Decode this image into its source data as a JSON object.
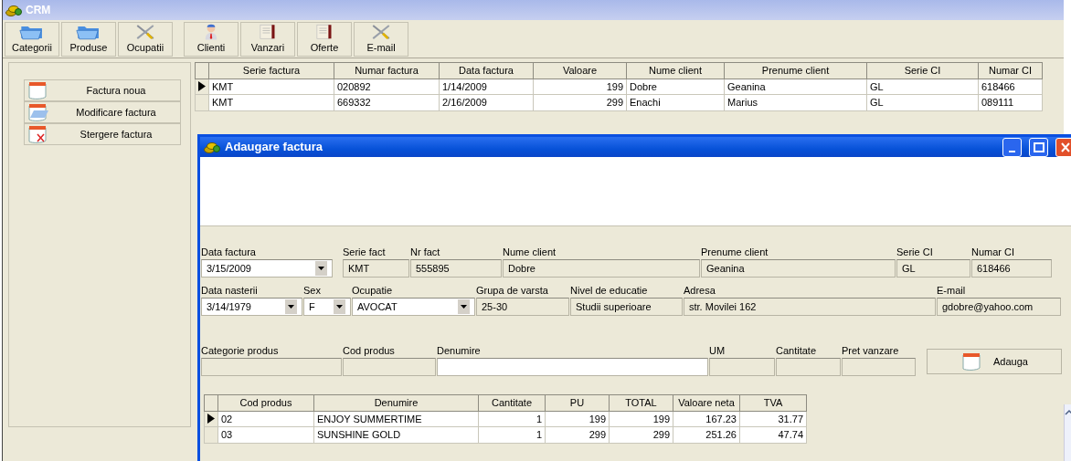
{
  "window": {
    "title": "CRM"
  },
  "toolbar": [
    {
      "label": "Categorii",
      "kind": "folder"
    },
    {
      "label": "Produse",
      "kind": "folder"
    },
    {
      "label": "Ocupatii",
      "kind": "tools"
    },
    {
      "label": "Clienti",
      "kind": "person"
    },
    {
      "label": "Vanzari",
      "kind": "ledger"
    },
    {
      "label": "Oferte",
      "kind": "ledger"
    },
    {
      "label": "E-mail",
      "kind": "tools"
    }
  ],
  "actions": [
    {
      "label": "Factura noua",
      "kind": "new"
    },
    {
      "label": "Modificare factura",
      "kind": "edit"
    },
    {
      "label": "Stergere factura",
      "kind": "delete"
    }
  ],
  "invoices": {
    "columns": [
      "Serie factura",
      "Numar factura",
      "Data factura",
      "Valoare",
      "Nume client",
      "Prenume client",
      "Serie CI",
      "Numar CI"
    ],
    "rows": [
      {
        "selected": true,
        "cells": [
          "KMT",
          "020892",
          "1/14/2009",
          "199",
          "Dobre",
          "Geanina",
          "GL",
          "618466"
        ]
      },
      {
        "selected": false,
        "cells": [
          "KMT",
          "669332",
          "2/16/2009",
          "299",
          "Enachi",
          "Marius",
          "GL",
          "089111"
        ]
      }
    ]
  },
  "dialog": {
    "title": "Adaugare factura",
    "form_rows": [
      [
        {
          "label": "Data factura",
          "value": "3/15/2009",
          "kind": "date"
        },
        {
          "label": "Serie fact",
          "value": "KMT",
          "kind": "readonly"
        },
        {
          "label": "Nr fact",
          "value": "555895",
          "kind": "readonly"
        },
        {
          "label": "Nume client",
          "value": "Dobre",
          "kind": "readonly"
        },
        {
          "label": "Prenume client",
          "value": "Geanina",
          "kind": "readonly"
        },
        {
          "label": "Serie CI",
          "value": "GL",
          "kind": "readonly"
        },
        {
          "label": "Numar CI",
          "value": "618466",
          "kind": "readonly"
        }
      ],
      [
        {
          "label": "Data nasterii",
          "value": "3/14/1979",
          "kind": "date"
        },
        {
          "label": "Sex",
          "value": "F",
          "kind": "combo"
        },
        {
          "label": "Ocupatie",
          "value": "AVOCAT",
          "kind": "combo"
        },
        {
          "label": "Grupa de varsta",
          "value": "25-30",
          "kind": "readonly"
        },
        {
          "label": "Nivel de educatie",
          "value": "Studii superioare",
          "kind": "readonly"
        },
        {
          "label": "Adresa",
          "value": "str. Movilei 162",
          "kind": "readonly"
        },
        {
          "label": "E-mail",
          "value": "gdobre@yahoo.com",
          "kind": "readonly"
        }
      ],
      [
        {
          "label": "Categorie produs",
          "kind": "readonly"
        },
        {
          "label": "Cod produs",
          "kind": "readonly"
        },
        {
          "label": "Denumire",
          "kind": "input"
        },
        {
          "label": "UM",
          "kind": "readonly"
        },
        {
          "label": "Cantitate",
          "kind": "readonly"
        },
        {
          "label": "Pret vanzare",
          "kind": "readonly"
        }
      ]
    ],
    "add_button": "Adauga",
    "items": {
      "columns": [
        "Cod produs",
        "Denumire",
        "Cantitate",
        "PU",
        "TOTAL",
        "Valoare neta",
        "TVA"
      ],
      "rows": [
        {
          "selected": true,
          "cells": [
            "02",
            "ENJOY SUMMERTIME",
            "1",
            "199",
            "199",
            "167.23",
            "31.77"
          ]
        },
        {
          "selected": false,
          "cells": [
            "03",
            "SUNSHINE GOLD",
            "1",
            "299",
            "299",
            "251.26",
            "47.74"
          ]
        }
      ]
    }
  }
}
